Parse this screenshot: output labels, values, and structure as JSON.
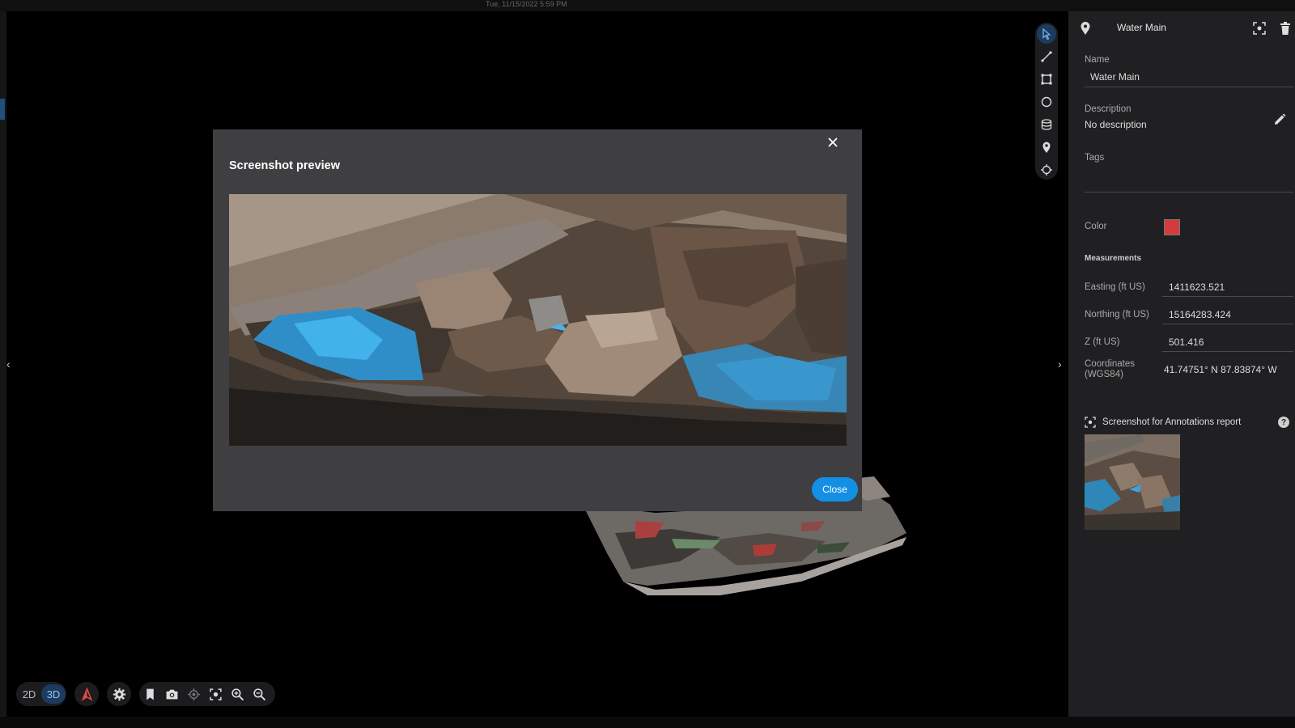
{
  "viewport": {
    "top_title": "Tue, 11/15/2022 5:59 PM",
    "mode_2d": "2D",
    "mode_3d": "3D",
    "active_mode": "3D"
  },
  "toolstrip": {
    "tools": [
      "select-icon",
      "line-measure-icon",
      "area-measure-icon",
      "circle-icon",
      "volume-icon",
      "pin-icon",
      "point-icon"
    ],
    "active_tool": "select-icon"
  },
  "bottom_toolbar": {
    "icons": [
      "north-arrow-icon",
      "settings-icon",
      "bookmark-icon",
      "camera-icon",
      "locate-icon",
      "focus-icon",
      "zoom-in-icon",
      "zoom-out-icon"
    ]
  },
  "modal": {
    "title": "Screenshot preview",
    "close_label": "Close"
  },
  "panel": {
    "header_title": "Water Main",
    "name_label": "Name",
    "name_value": "Water Main",
    "description_label": "Description",
    "description_value": "No description",
    "tags_label": "Tags",
    "color_label": "Color",
    "color_value": "#d33c3c",
    "measurements_title": "Measurements",
    "easting_label": "Easting (ft US)",
    "easting_value": "1411623.521",
    "northing_label": "Northing (ft US)",
    "northing_value": "15164283.424",
    "z_label": "Z (ft US)",
    "z_value": "501.416",
    "coords_label_1": "Coordinates",
    "coords_label_2": "(WGS84)",
    "coords_value": "41.74751° N 87.83874° W",
    "screenshot_label": "Screenshot for Annotations report"
  },
  "colors": {
    "accent": "#1390e4",
    "panel_bg": "#202022",
    "modal_bg": "#3f3f41",
    "active_tool_bg": "#1d3b5e"
  }
}
